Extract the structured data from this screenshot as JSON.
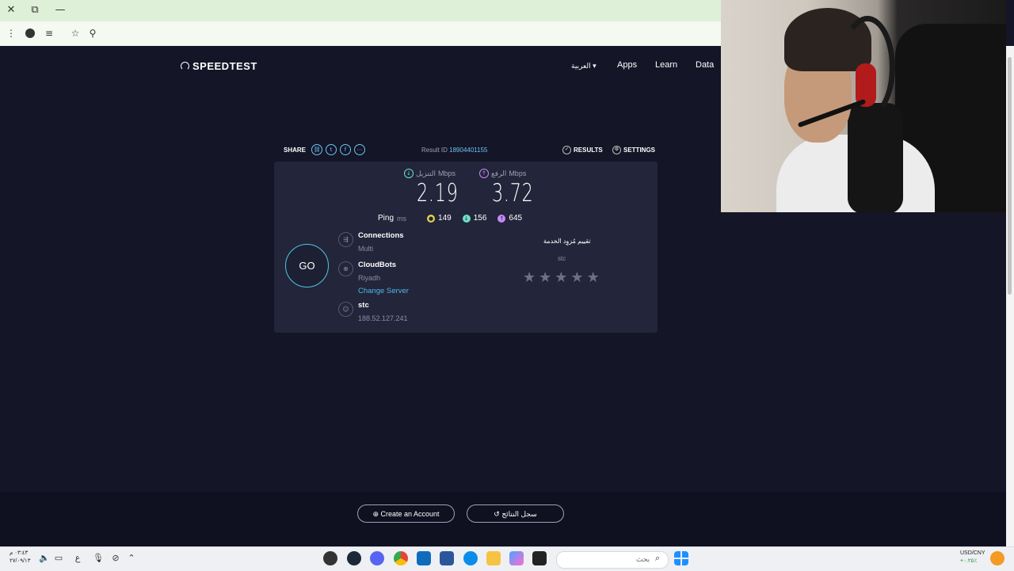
{
  "browser": {
    "close_glyph": "✕",
    "restore_glyph": "⧉",
    "minimize_glyph": "—",
    "menu_glyph": "⋮",
    "star_glyph": "☆",
    "location_glyph": "⚲",
    "list_glyph": "≡"
  },
  "header": {
    "logo_text": "SPEEDTEST",
    "lang": "العربية ▾",
    "nav": [
      "Apps",
      "Learn",
      "Data"
    ]
  },
  "share_bar": {
    "share_label": "SHARE",
    "result_id_label": "Result ID",
    "result_id_value": "18904401155",
    "results_label": "RESULTS",
    "settings_label": "SETTINGS"
  },
  "metrics": {
    "download": {
      "label": "التنزيل",
      "unit": "Mbps",
      "value": "2.19"
    },
    "upload": {
      "label": "الرفع",
      "unit": "Mbps",
      "value": "3.72"
    }
  },
  "ping": {
    "label": "Ping",
    "unit": "ms",
    "idle": "149",
    "download": "156",
    "upload": "645"
  },
  "go_label": "GO",
  "connection": {
    "connections_title": "Connections",
    "connections_value": "Multi",
    "server_name": "CloudBots",
    "server_city": "Riyadh",
    "change_server": "Change Server",
    "isp_name": "stc",
    "ip_address": "188.52.127.241"
  },
  "rating": {
    "title": "تقييم مُزوِد الخدمة",
    "isp": "stc",
    "stars_total": 5,
    "stars_filled": 0
  },
  "footer": {
    "create_account": "Create an Account",
    "history": "سجل النتائج"
  },
  "taskbar": {
    "time": "٠٣:٤٣ م",
    "date": "٢٧/٠٩/١٣",
    "lang_indicator": "ع",
    "search_placeholder": "بحث",
    "currency_pair": "USD/CNY",
    "currency_change": "+٠.٢٥٪"
  },
  "colors": {
    "background": "#141526",
    "panel": "#23253a",
    "download": "#6de1c8",
    "upload": "#c58af9",
    "ping": "#e3d44c",
    "link": "#4fb7e8"
  }
}
